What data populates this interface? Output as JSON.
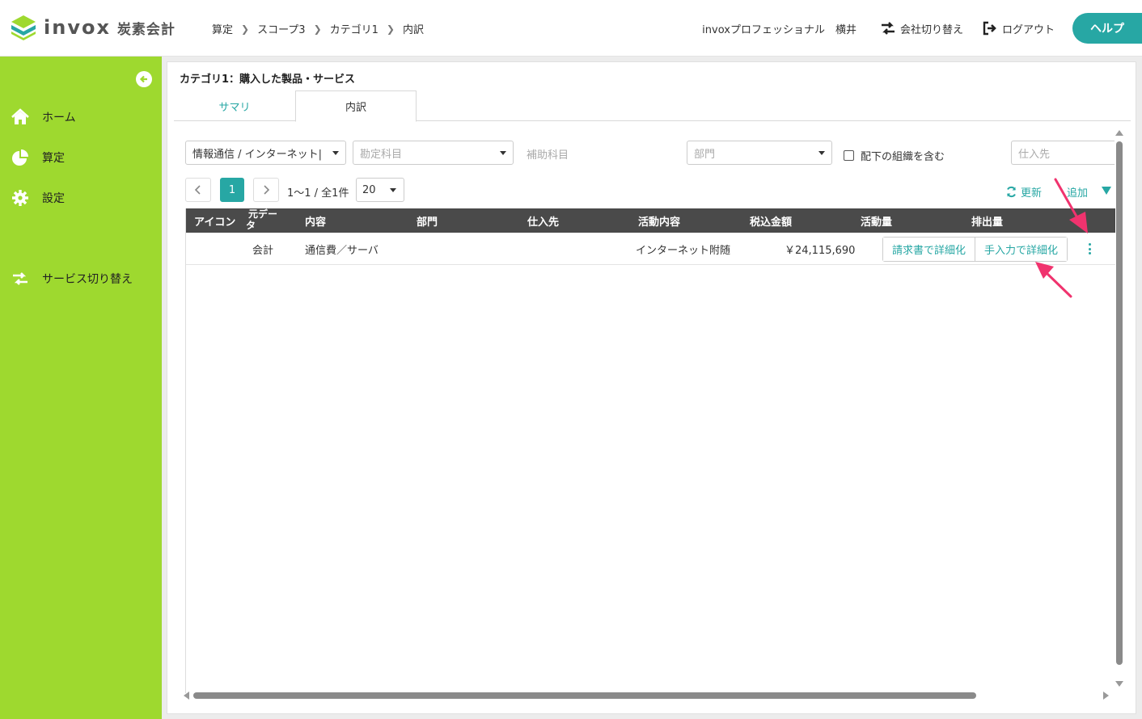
{
  "header": {
    "logo_word": "invox",
    "logo_sub": "炭素会計",
    "breadcrumb": [
      "算定",
      "スコープ3",
      "カテゴリ1",
      "内訳"
    ],
    "user": "invoxプロフェッショナル　横井",
    "switch_company": "会社切り替え",
    "logout": "ログアウト",
    "help": "ヘルプ"
  },
  "sidebar": {
    "items": [
      {
        "label": "ホーム",
        "icon": "home-icon"
      },
      {
        "label": "算定",
        "icon": "pie-chart-icon"
      },
      {
        "label": "設定",
        "icon": "gear-icon"
      },
      {
        "label": "サービス切り替え",
        "icon": "switch-icon"
      }
    ]
  },
  "panel": {
    "title": "カテゴリ1：購入した製品・サービス",
    "tabs": [
      {
        "label": "サマリ",
        "active": false
      },
      {
        "label": "内訳",
        "active": true
      }
    ]
  },
  "filters": {
    "industry_value": "情報通信 / インターネット|",
    "account_placeholder": "勘定科目",
    "sub_account_label": "補助科目",
    "department_placeholder": "部門",
    "include_children_label": "配下の組織を含む",
    "supplier_placeholder": "仕入先"
  },
  "pagination": {
    "prev": "<",
    "current_page": "1",
    "next": ">",
    "info": "1〜1 / 全1件",
    "per_page": "20"
  },
  "actions": {
    "refresh": "更新",
    "add": "追加"
  },
  "table": {
    "headers": {
      "icon": "アイコン",
      "source_line1": "元デー",
      "source_line2": "タ",
      "content": "内容",
      "department": "部門",
      "supplier": "仕入先",
      "activity": "活動内容",
      "amount": "税込金額",
      "activity_amount": "活動量",
      "emission": "排出量"
    },
    "rows": [
      {
        "source": "会計",
        "content": "通信費／サーバ",
        "department": "",
        "supplier": "",
        "activity": "インターネット附随",
        "amount": "￥24,115,690",
        "btn_invoice": "請求書で詳細化",
        "btn_manual": "手入力で詳細化"
      }
    ]
  },
  "colors": {
    "accent": "#27a7a4",
    "sidebar": "#9ed92f",
    "annotation": "#f0336e"
  }
}
